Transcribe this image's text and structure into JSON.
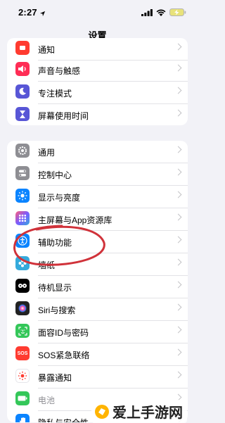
{
  "status": {
    "time": "2:27"
  },
  "nav": {
    "title": "设置"
  },
  "group1": {
    "items": [
      {
        "label": "通知",
        "icon": "bell-icon",
        "color": "#ff3b30"
      },
      {
        "label": "声音与触感",
        "icon": "speaker-icon",
        "color": "#ff2d55"
      },
      {
        "label": "专注模式",
        "icon": "moon-icon",
        "color": "#5856d6"
      },
      {
        "label": "屏幕使用时间",
        "icon": "hourglass-icon",
        "color": "#5856d6"
      }
    ]
  },
  "group2": {
    "items": [
      {
        "label": "通用",
        "icon": "gear-icon",
        "color": "#8e8e93"
      },
      {
        "label": "控制中心",
        "icon": "switches-icon",
        "color": "#8e8e93"
      },
      {
        "label": "显示与亮度",
        "icon": "sun-icon",
        "color": "#0a84ff"
      },
      {
        "label": "主屏幕与App资源库",
        "icon": "app-grid-icon",
        "color": "#5856d6"
      },
      {
        "label": "辅助功能",
        "icon": "accessibility-icon",
        "color": "#0a84ff"
      },
      {
        "label": "墙纸",
        "icon": "wallpaper-icon",
        "color": "#34aadc"
      },
      {
        "label": "待机显示",
        "icon": "standby-icon",
        "color": "#000000"
      },
      {
        "label": "Siri与搜索",
        "icon": "siri-icon",
        "color": "#222222"
      },
      {
        "label": "面容ID与密码",
        "icon": "face-id-icon",
        "color": "#34c759"
      },
      {
        "label": "SOS紧急联络",
        "icon": "sos-icon",
        "color": "#ff3b30"
      },
      {
        "label": "暴露通知",
        "icon": "exposure-icon",
        "color": "#ffffff"
      },
      {
        "label": "电池",
        "icon": "battery-icon",
        "color": "#34c759"
      },
      {
        "label": "隐私与安全性",
        "icon": "hand-icon",
        "color": "#0a84ff"
      }
    ]
  },
  "watermark": {
    "text": "爱上手游网"
  },
  "annotation_color": "#d0323a"
}
